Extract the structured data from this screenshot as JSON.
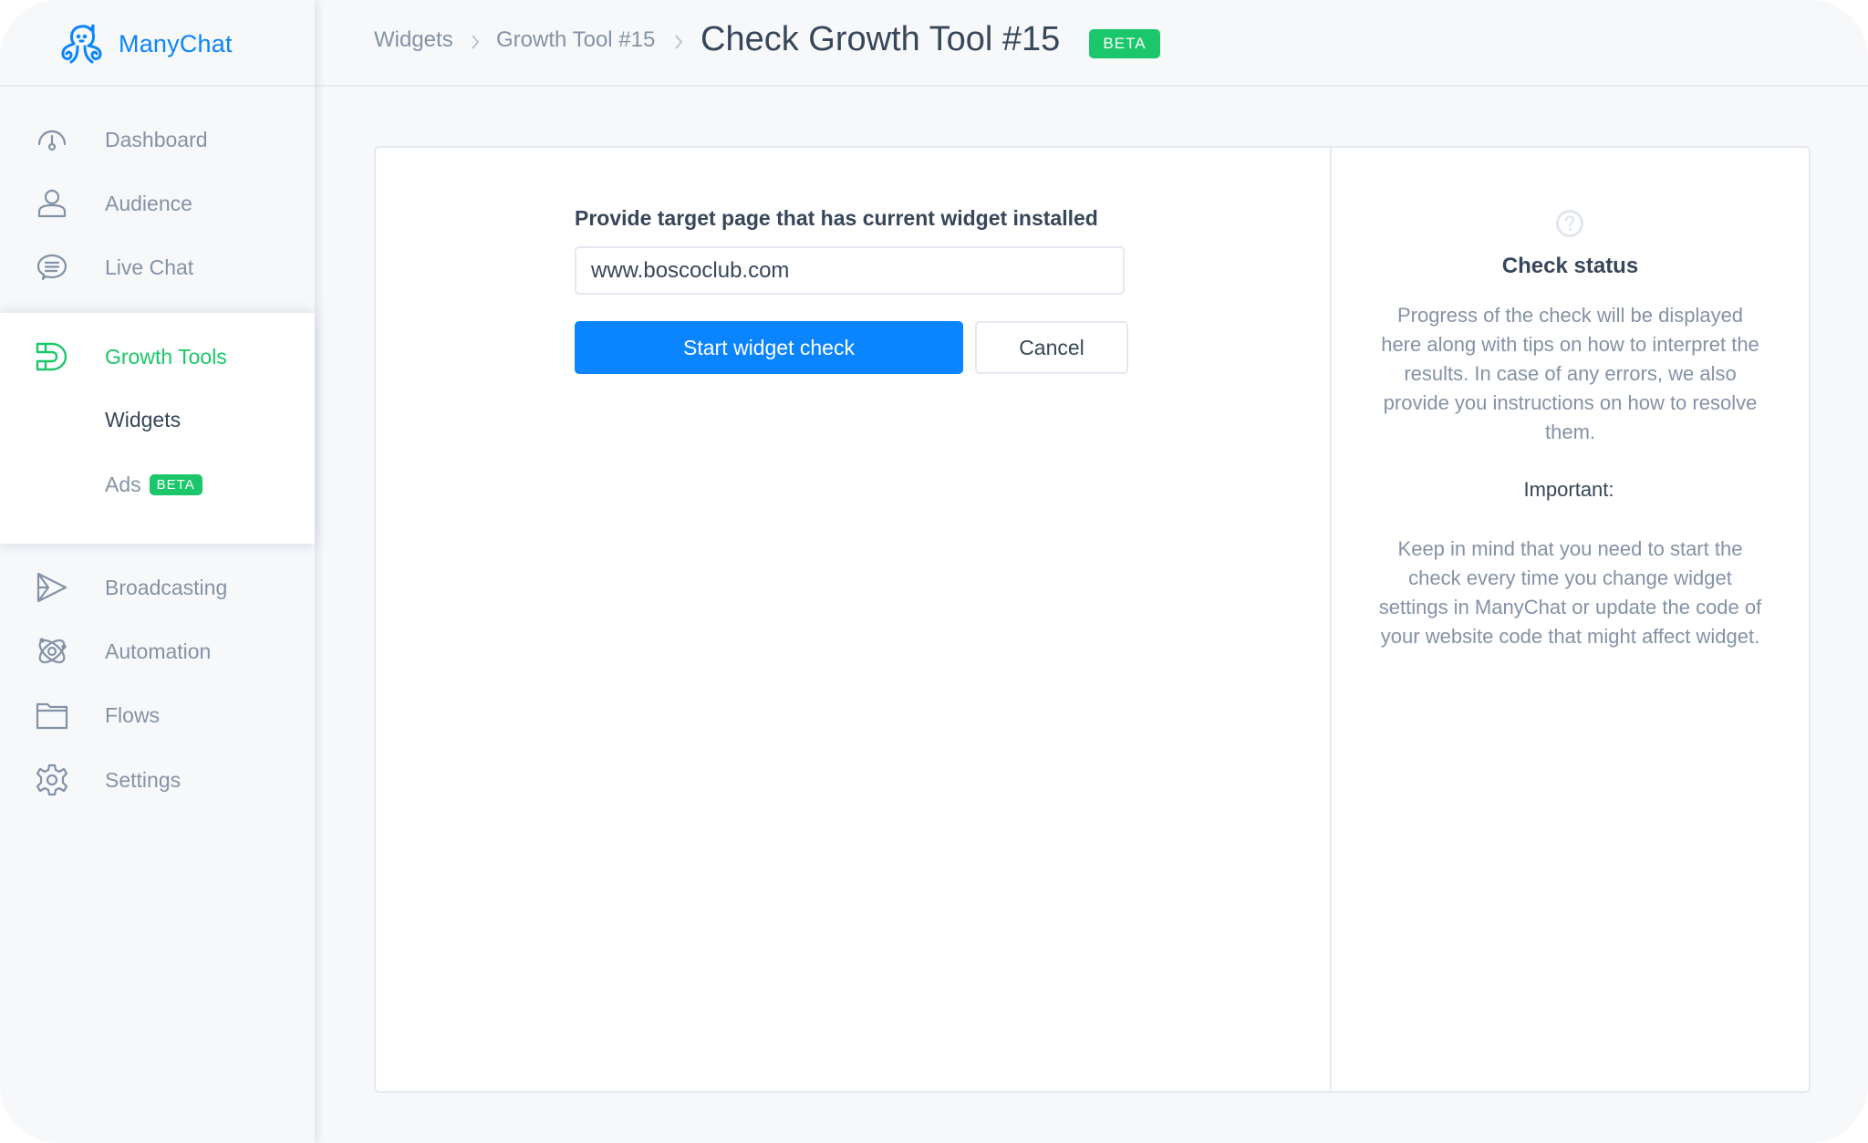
{
  "app": {
    "brand": "ManyChat",
    "brand_color": "#0a84ff",
    "active_color": "#1bc76a"
  },
  "sidebar": {
    "items": [
      {
        "label": "Dashboard",
        "icon": "dashboard-gauge-icon"
      },
      {
        "label": "Audience",
        "icon": "user-icon"
      },
      {
        "label": "Live Chat",
        "icon": "chat-bubble-icon"
      },
      {
        "label": "Growth Tools",
        "icon": "magnet-icon",
        "active": true
      },
      {
        "label": "Broadcasting",
        "icon": "send-icon"
      },
      {
        "label": "Automation",
        "icon": "atom-icon"
      },
      {
        "label": "Flows",
        "icon": "folder-icon"
      },
      {
        "label": "Settings",
        "icon": "gear-icon"
      }
    ],
    "sub_items": [
      {
        "label": "Widgets",
        "current": true
      },
      {
        "label": "Ads",
        "badge": "BETA"
      }
    ]
  },
  "header": {
    "breadcrumb": [
      "Widgets",
      "Growth Tool #15"
    ],
    "title": "Check Growth Tool #15",
    "badge": "BETA"
  },
  "form": {
    "label": "Provide target page that has current widget installed",
    "url_value": "www.boscoclub.com",
    "start_button": "Start widget check",
    "cancel_button": "Cancel"
  },
  "status": {
    "icon": "question-circle-icon",
    "title": "Check status",
    "description": "Progress of the check will be displayed here along with tips on how to interpret the results. In case of any errors, we also provide you instructions on how to resolve them.",
    "important_label": "Important:",
    "important_text": "Keep in mind that you need to start the check every time you change widget settings in ManyChat or update the code of your website code that might affect widget."
  }
}
